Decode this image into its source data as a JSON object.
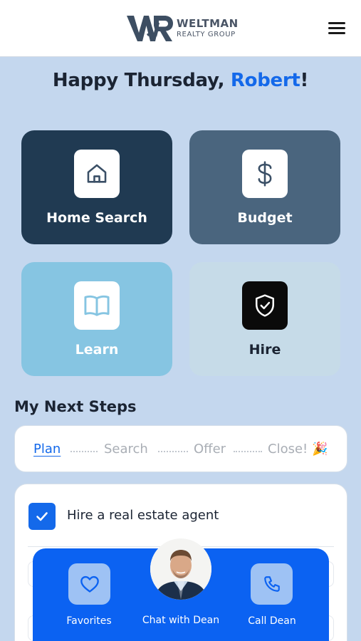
{
  "header": {
    "logo_name": "WELTMAN",
    "logo_sub": "REALTY GROUP",
    "logo_icon": "weltman-wr-logo",
    "menu_icon": "hamburger-menu-icon"
  },
  "greeting": {
    "prefix": "Happy Thursday, ",
    "name": "Robert",
    "suffix": "!"
  },
  "tiles": [
    {
      "label": "Home Search",
      "icon": "house-icon"
    },
    {
      "label": "Budget",
      "icon": "dollar-icon"
    },
    {
      "label": "Learn",
      "icon": "book-icon"
    },
    {
      "label": "Hire",
      "icon": "shield-check-icon"
    }
  ],
  "next_steps": {
    "title": "My Next Steps",
    "steps": [
      {
        "label": "Plan",
        "active": true
      },
      {
        "label": "Search",
        "active": false
      },
      {
        "label": "Offer",
        "active": false
      },
      {
        "label": "Close! 🎉",
        "active": false
      }
    ],
    "tasks": [
      {
        "label": "Hire a real estate agent",
        "checked": true
      }
    ]
  },
  "bottom_bar": {
    "favorites": "Favorites",
    "chat": "Chat with Dean",
    "call": "Call Dean"
  },
  "colors": {
    "accent": "#1469ea",
    "background": "#c4d7ee",
    "bottom_bar": "#0b62f2",
    "tile_home": "#203a52",
    "tile_budget": "#4a657e",
    "tile_learn": "#86c5e2",
    "tile_hire": "#c6dbe8"
  }
}
